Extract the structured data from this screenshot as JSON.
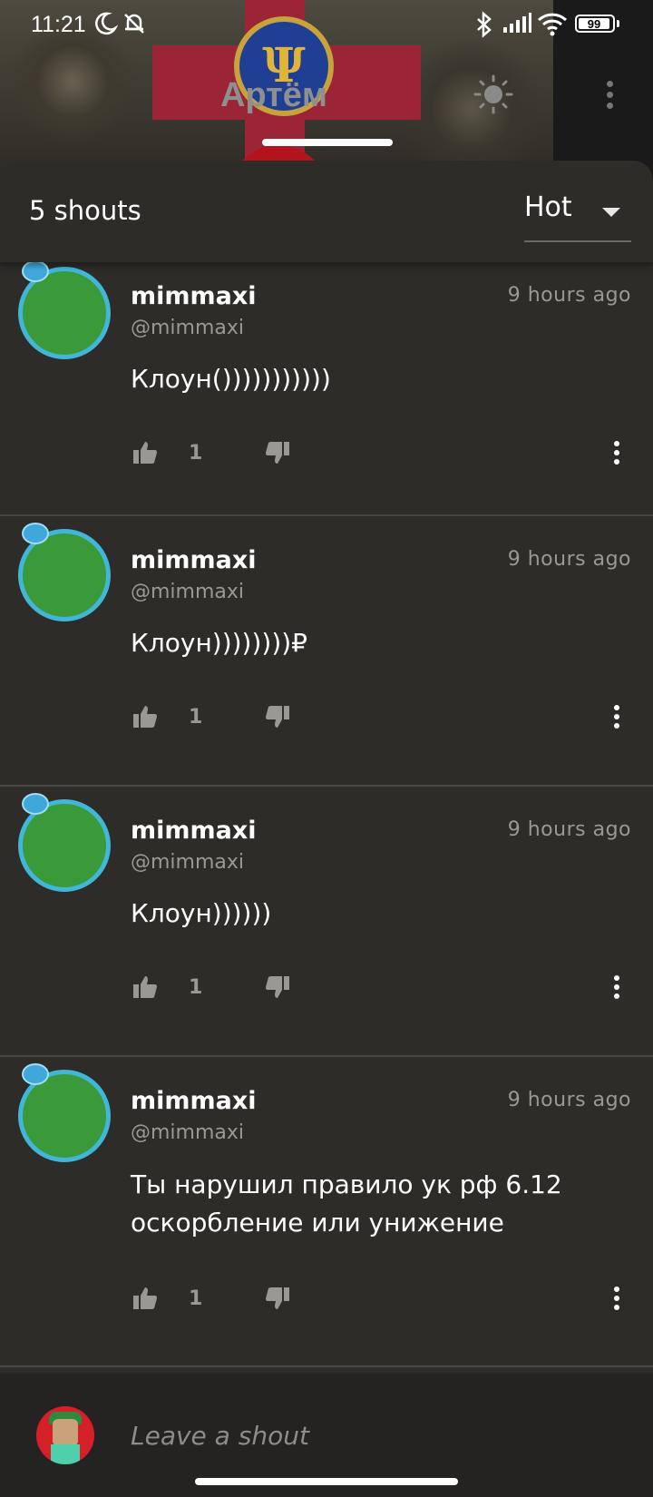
{
  "status_bar": {
    "time": "11:21",
    "battery": "99"
  },
  "profile": {
    "name": "Артём"
  },
  "sheet": {
    "shout_count_label": "5 shouts",
    "sort": {
      "selected": "Hot"
    }
  },
  "shouts": [
    {
      "username": "mimmaxi",
      "handle": "@mimmaxi",
      "time": "9 hours ago",
      "message": "Клоун()))))))))))",
      "likes": "1"
    },
    {
      "username": "mimmaxi",
      "handle": "@mimmaxi",
      "time": "9 hours ago",
      "message": "Клоун))))))))₽",
      "likes": "1"
    },
    {
      "username": "mimmaxi",
      "handle": "@mimmaxi",
      "time": "9 hours ago",
      "message": "Клоун))))))",
      "likes": "1"
    },
    {
      "username": "mimmaxi",
      "handle": "@mimmaxi",
      "time": "9 hours ago",
      "message": "Ты нарушил правило ук рф 6.12 оскорбление или унижение",
      "likes": "1"
    }
  ],
  "composer": {
    "placeholder": "Leave a shout"
  },
  "colors": {
    "sheet_bg": "#2e2c29",
    "avatar_ring": "#42b6d9",
    "muted_text": "#9a9894"
  }
}
